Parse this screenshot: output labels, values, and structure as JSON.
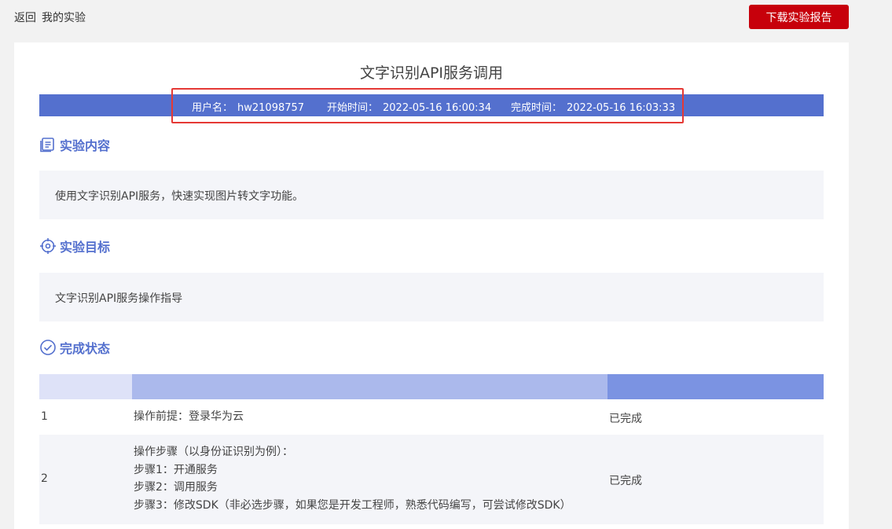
{
  "topbar": {
    "back_label": "返回",
    "page_label": "我的实验",
    "download_label": "下载实验报告"
  },
  "experiment": {
    "title": "文字识别API服务调用",
    "info": {
      "user_label": "用户名：",
      "user_value": "hw21098757",
      "start_label": "开始时间：",
      "start_value": "2022-05-16 16:00:34",
      "end_label": "完成时间：",
      "end_value": "2022-05-16 16:03:33"
    }
  },
  "sections": {
    "content": {
      "title": "实验内容",
      "icon": "document-list-icon",
      "text": "使用文字识别API服务，快速实现图片转文字功能。"
    },
    "goal": {
      "title": "实验目标",
      "icon": "target-icon",
      "text": "文字识别API服务操作指导"
    },
    "status": {
      "title": "完成状态",
      "icon": "check-circle-icon",
      "rows": [
        {
          "num": "1",
          "lines": [
            "操作前提：登录华为云"
          ],
          "status": "已完成"
        },
        {
          "num": "2",
          "lines": [
            "操作步骤（以身份证识别为例）：",
            "步骤1：开通服务",
            "步骤2：调用服务",
            "步骤3：修改SDK（非必选步骤，如果您是开发工程师，熟悉代码编写，可尝试修改SDK）"
          ],
          "status": "已完成"
        }
      ]
    }
  },
  "colors": {
    "accent": "#5470ce",
    "download": "#c7000b",
    "highlight": "#e53935"
  }
}
